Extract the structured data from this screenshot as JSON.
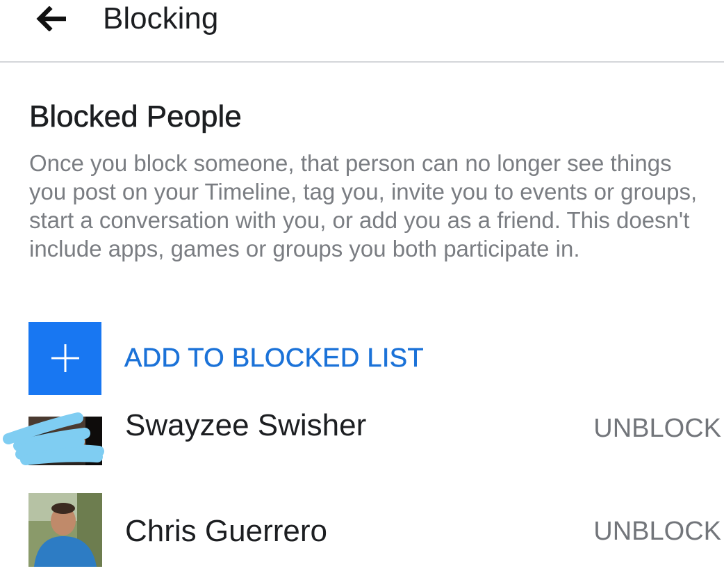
{
  "header": {
    "back_icon": "arrow-left-icon",
    "title": "Blocking"
  },
  "blocked_people": {
    "title": "Blocked People",
    "description": "Once you block someone, that person can no longer see things you post on your Timeline, tag you, invite you to events or groups, start a conversation with you, or add you as a friend. This doesn't include apps, games or groups you both participate in.",
    "add_button": {
      "icon": "plus-icon",
      "label": "ADD TO BLOCKED LIST"
    },
    "people": [
      {
        "name": "Swayzee Swisher",
        "action": "UNBLOCK"
      },
      {
        "name": "Chris Guerrero",
        "action": "UNBLOCK"
      }
    ]
  },
  "colors": {
    "accent": "#1877f2",
    "accent_text": "#1b72d8",
    "secondary_text": "#7a7d82",
    "divider": "#d4d6da",
    "redaction": "#7fcdf2"
  }
}
